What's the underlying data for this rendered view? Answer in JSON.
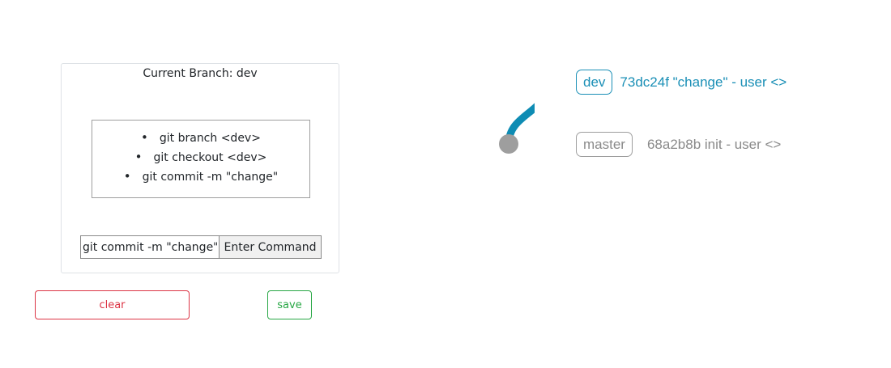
{
  "terminal": {
    "current_branch": "Current Branch: dev",
    "history": [
      "git branch <dev>",
      "git checkout <dev>",
      "git commit -m \"change\""
    ],
    "command_input_value": "git commit -m \"change\"",
    "enter_button_label": "Enter Command"
  },
  "actions": {
    "clear_label": "clear",
    "save_label": "save"
  },
  "graph": {
    "commits": [
      {
        "branch": "dev",
        "message": "73dc24f \"change\" - user <>",
        "color": "#0e8cb4",
        "head": true
      },
      {
        "branch": "master",
        "message": "68a2b8b init - user <>",
        "color": "#9e9e9e",
        "head": false
      }
    ]
  },
  "colors": {
    "dev": "#0e8cb4",
    "master": "#9e9e9e",
    "clear": "#dc3545",
    "save": "#28a745"
  }
}
